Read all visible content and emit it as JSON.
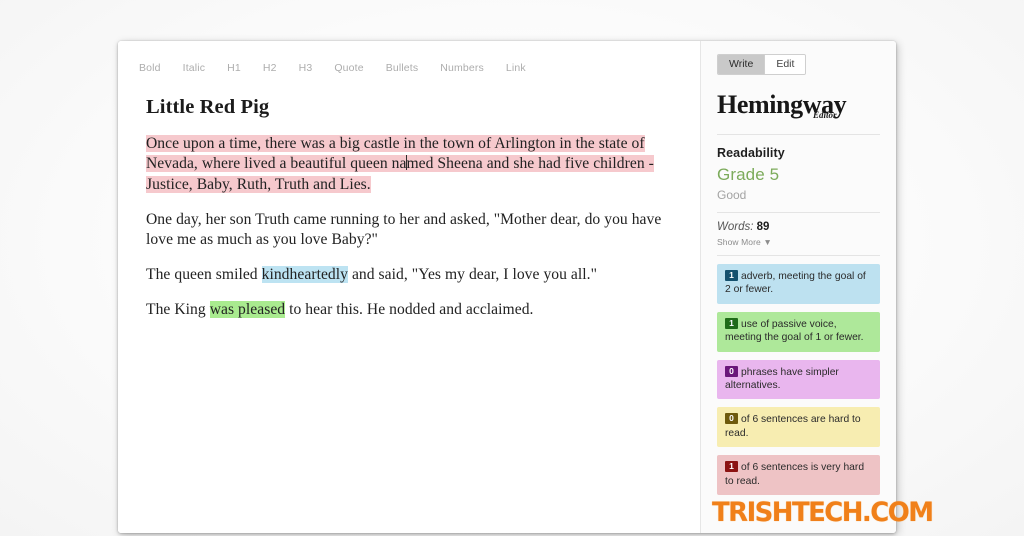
{
  "app": {
    "name": "Hemingway Editor",
    "brand_name": "Hemingway",
    "brand_sub": "Editor"
  },
  "toolbar": {
    "items": [
      {
        "label": "Bold"
      },
      {
        "label": "Italic"
      },
      {
        "label": "H1"
      },
      {
        "label": "H2"
      },
      {
        "label": "H3"
      },
      {
        "label": "Quote"
      },
      {
        "label": "Bullets"
      },
      {
        "label": "Numbers"
      },
      {
        "label": "Link"
      }
    ]
  },
  "mode_toggle": {
    "write_label": "Write",
    "edit_label": "Edit",
    "active": "Write"
  },
  "document": {
    "title": "Little Red Pig",
    "paragraphs": [
      {
        "id": "p1",
        "highlight": "very-hard",
        "text": "Once upon a time, there was a big castle in the town of Arlington in the state of Nevada, where lived a beautiful queen named Sheena and she had five children - Justice, Baby, Ruth, Truth and Lies."
      },
      {
        "id": "p2",
        "highlight": "none",
        "text": "One day, her son Truth came running to her and asked, \"Mother dear, do you have love me as much as you love Baby?\""
      },
      {
        "id": "p3",
        "highlight": "adverb-inline",
        "text_before": "The queen smiled ",
        "text_highlight": "kindheartedly",
        "text_after": " and said, \"Yes my dear, I love you all.\""
      },
      {
        "id": "p4",
        "highlight": "passive-inline",
        "text_before": "The King ",
        "text_highlight": "was pleased",
        "text_after": " to hear this. He nodded and acclaimed."
      }
    ]
  },
  "sidebar": {
    "readability_label": "Readability",
    "grade": "Grade 5",
    "grade_desc": "Good",
    "words_label": "Words:",
    "words_value": "89",
    "show_more_label": "Show More",
    "show_more_icon": "chevron-down-icon",
    "stats": [
      {
        "key": "adverbs",
        "count": "1",
        "text": "adverb, meeting the goal of 2 or fewer.",
        "color": "#bde1f0",
        "badge_color": "#14516e"
      },
      {
        "key": "passive-voice",
        "count": "1",
        "text": "use of passive voice, meeting the goal of 1 or fewer.",
        "color": "#aee89a",
        "badge_color": "#1f6b18"
      },
      {
        "key": "simpler-alternatives",
        "count": "0",
        "text": "phrases have simpler alternatives.",
        "color": "#e9b6ee",
        "badge_color": "#6a177a"
      },
      {
        "key": "hard-sentences",
        "count": "0",
        "text": "of 6 sentences are hard to read.",
        "color": "#f7edb1",
        "badge_color": "#6e5a0c"
      },
      {
        "key": "very-hard-sentences",
        "count": "1",
        "text": "of 6 sentences is very hard to read.",
        "color": "#eec3c5",
        "badge_color": "#8b1212"
      }
    ]
  },
  "watermark": {
    "text": "TRISHTECH.COM",
    "color": "#f0801a"
  },
  "colors": {
    "highlight_very_hard": "#f6c9cd",
    "highlight_adverb": "#bde3f2",
    "highlight_passive": "#a9eb8f",
    "grade_green": "#7cab5b"
  }
}
